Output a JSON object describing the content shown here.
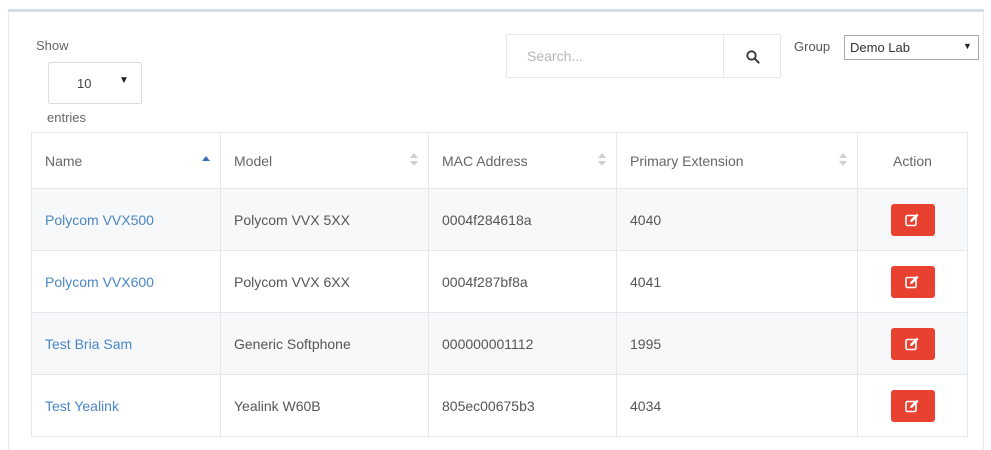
{
  "length": {
    "show_label": "Show",
    "value": "10",
    "entries_label": "entries",
    "caret_icon": "dropdown-caret-icon"
  },
  "search": {
    "placeholder": "Search...",
    "icon": "search-icon"
  },
  "group": {
    "label": "Group",
    "value": "Demo Lab",
    "caret_icon": "dropdown-caret-icon"
  },
  "table": {
    "columns": [
      {
        "label": "Name",
        "sort": "ascending"
      },
      {
        "label": "Model",
        "sort": "none"
      },
      {
        "label": "MAC Address",
        "sort": "none"
      },
      {
        "label": "Primary Extension",
        "sort": "none"
      },
      {
        "label": "Action"
      }
    ],
    "rows": [
      {
        "name": "Polycom VVX500",
        "model": "Polycom VVX 5XX",
        "mac": "0004f284618a",
        "extension": "4040"
      },
      {
        "name": "Polycom VVX600",
        "model": "Polycom VVX 6XX",
        "mac": "0004f287bf8a",
        "extension": "4041"
      },
      {
        "name": "Test Bria Sam",
        "model": "Generic Softphone",
        "mac": "000000001112",
        "extension": "1995"
      },
      {
        "name": "Test Yealink",
        "model": "Yealink W60B",
        "mac": "805ec00675b3",
        "extension": "4034"
      }
    ],
    "action_icon": "edit-icon"
  },
  "colors": {
    "link": "#4a86c5",
    "edit_button": "#e8412f",
    "sort_active": "#3b6fb6",
    "row_stripe": "#f7f8f9"
  }
}
